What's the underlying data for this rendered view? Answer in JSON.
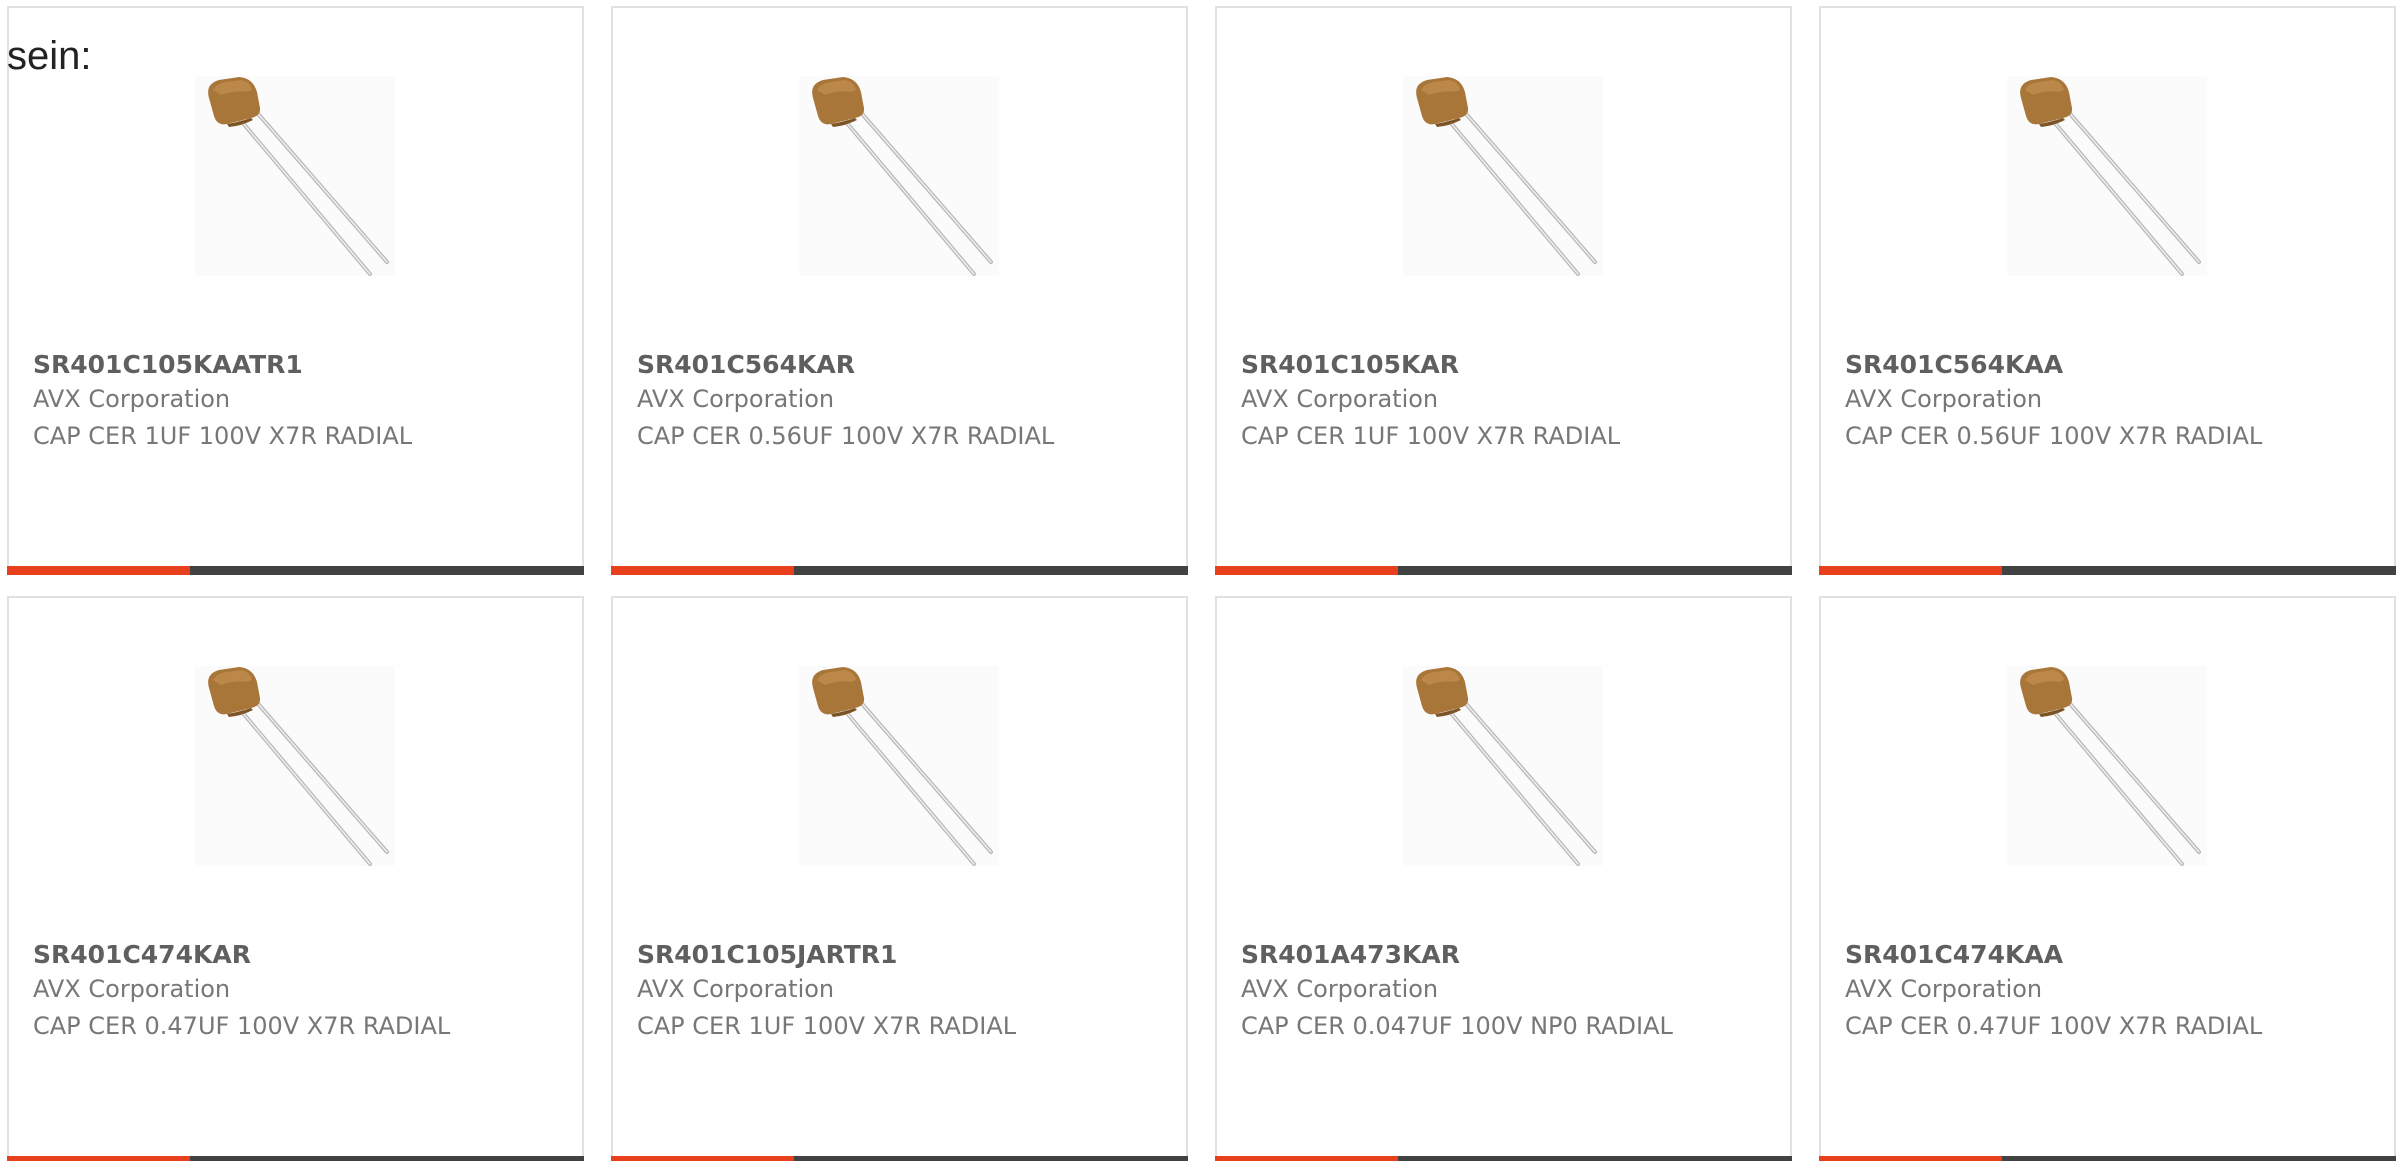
{
  "intro_text": "sein:",
  "colors": {
    "accent": "#e8401c",
    "bar_dark": "#424242",
    "card_border": "#e1e1e1",
    "part_number": "#5f5f5f",
    "body_text": "#777777"
  },
  "image_icon": "ceramic-capacitor-icon",
  "products": [
    {
      "part_number": "SR401C105KAATR1",
      "manufacturer": "AVX Corporation",
      "description": "CAP CER 1UF 100V X7R RADIAL"
    },
    {
      "part_number": "SR401C564KAR",
      "manufacturer": "AVX Corporation",
      "description": "CAP CER 0.56UF 100V X7R RADIAL"
    },
    {
      "part_number": "SR401C105KAR",
      "manufacturer": "AVX Corporation",
      "description": "CAP CER 1UF 100V X7R RADIAL"
    },
    {
      "part_number": "SR401C564KAA",
      "manufacturer": "AVX Corporation",
      "description": "CAP CER 0.56UF 100V X7R RADIAL"
    },
    {
      "part_number": "SR401C474KAR",
      "manufacturer": "AVX Corporation",
      "description": "CAP CER 0.47UF 100V X7R RADIAL"
    },
    {
      "part_number": "SR401C105JARTR1",
      "manufacturer": "AVX Corporation",
      "description": "CAP CER 1UF 100V X7R RADIAL"
    },
    {
      "part_number": "SR401A473KAR",
      "manufacturer": "AVX Corporation",
      "description": "CAP CER 0.047UF 100V NP0 RADIAL"
    },
    {
      "part_number": "SR401C474KAA",
      "manufacturer": "AVX Corporation",
      "description": "CAP CER 0.47UF 100V X7R RADIAL"
    }
  ]
}
